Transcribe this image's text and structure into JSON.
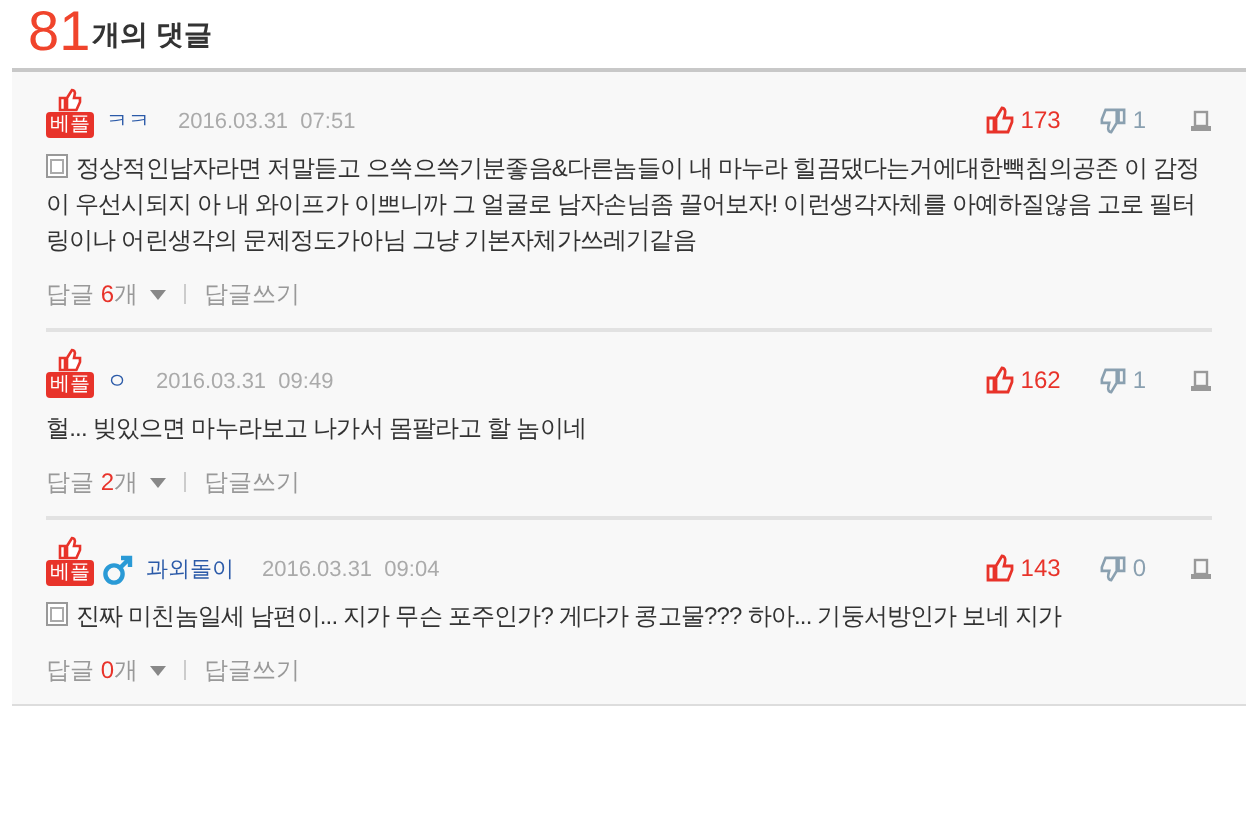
{
  "header": {
    "count": "81",
    "label": "개의 댓글"
  },
  "comments": [
    {
      "badge": "베플",
      "male_icon": false,
      "user": "ㅋㅋ",
      "date": "2016.03.31  07:51",
      "likes": "173",
      "dislikes": "1",
      "note_icon": true,
      "text": "정상적인남자라면 저말듣고 으쓱으쓱기분좋음&다른놈들이 내 마누라 힐끔댔다는거에대한빽침의공존 이 감정이 우선시되지 아 내 와이프가 이쁘니까 그 얼굴로 남자손님좀 끌어보자! 이런생각자체를 아예하질않음 고로 필터링이나 어린생각의 문제정도가아님 그냥 기본자체가쓰레기같음",
      "reply_label": "답글",
      "reply_count": "6",
      "reply_unit": "개",
      "write_reply": "답글쓰기"
    },
    {
      "badge": "베플",
      "male_icon": false,
      "user": "ㅇ",
      "date": "2016.03.31  09:49",
      "likes": "162",
      "dislikes": "1",
      "note_icon": false,
      "text": "헐... 빚있으면 마누라보고 나가서 몸팔라고 할 놈이네",
      "reply_label": "답글",
      "reply_count": "2",
      "reply_unit": "개",
      "write_reply": "답글쓰기"
    },
    {
      "badge": "베플",
      "male_icon": true,
      "user": "과외돌이",
      "date": "2016.03.31  09:04",
      "likes": "143",
      "dislikes": "0",
      "note_icon": true,
      "text": "진짜 미친놈일세 남편이... 지가 무슨 포주인가? 게다가 콩고물??? 하아... 기둥서방인가 보네 지가",
      "reply_label": "답글",
      "reply_count": "0",
      "reply_unit": "개",
      "write_reply": "답글쓰기"
    }
  ]
}
